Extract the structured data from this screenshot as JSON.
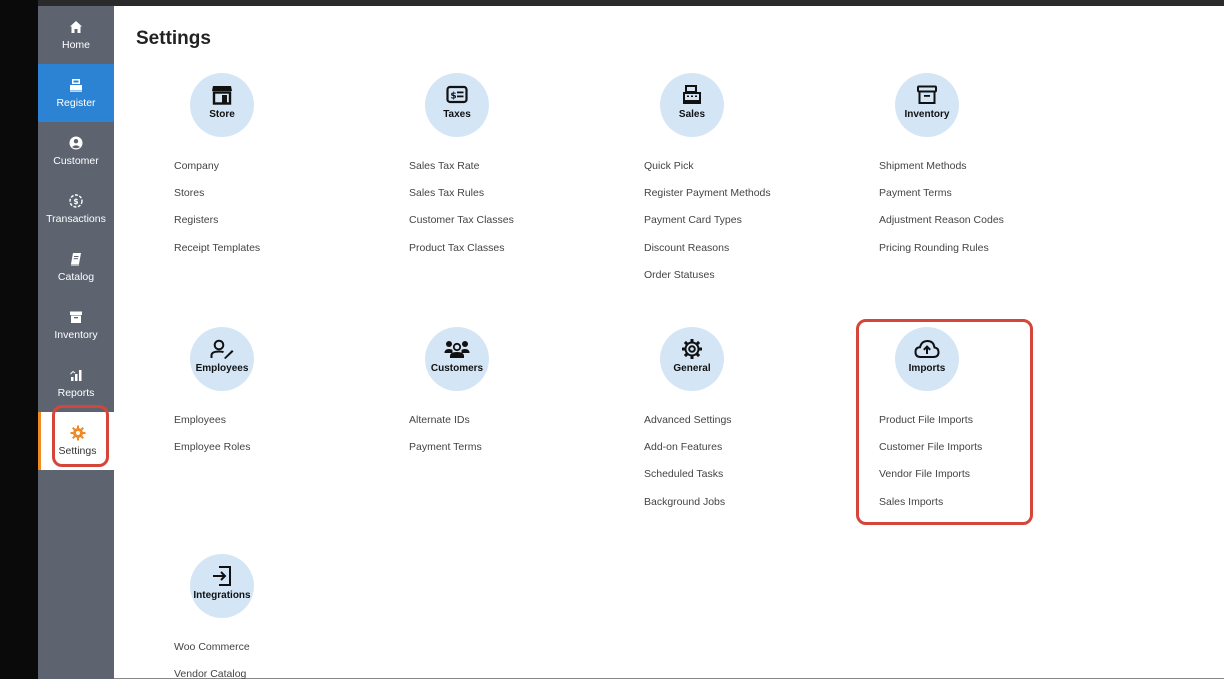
{
  "sidebar": {
    "items": [
      {
        "label": "Home",
        "icon": "home-icon"
      },
      {
        "label": "Register",
        "icon": "register-icon"
      },
      {
        "label": "Customer",
        "icon": "customer-icon"
      },
      {
        "label": "Transactions",
        "icon": "transactions-icon"
      },
      {
        "label": "Catalog",
        "icon": "catalog-icon"
      },
      {
        "label": "Inventory",
        "icon": "inventory-icon"
      },
      {
        "label": "Reports",
        "icon": "reports-icon"
      },
      {
        "label": "Settings",
        "icon": "settings-icon"
      }
    ],
    "active_color": "#2c83d3",
    "settings_accent": "#f08a24"
  },
  "page": {
    "title": "Settings"
  },
  "sections": {
    "store": {
      "title": "Store",
      "icon": "store-icon",
      "links": [
        "Company",
        "Stores",
        "Registers",
        "Receipt Templates"
      ]
    },
    "taxes": {
      "title": "Taxes",
      "icon": "taxes-icon",
      "links": [
        "Sales Tax Rate",
        "Sales Tax Rules",
        "Customer Tax Classes",
        "Product Tax Classes"
      ]
    },
    "sales": {
      "title": "Sales",
      "icon": "sales-icon",
      "links": [
        "Quick Pick",
        "Register Payment Methods",
        "Payment Card Types",
        "Discount Reasons",
        "Order Statuses"
      ]
    },
    "inventory": {
      "title": "Inventory",
      "icon": "inventory-box-icon",
      "links": [
        "Shipment Methods",
        "Payment Terms",
        "Adjustment Reason Codes",
        "Pricing Rounding Rules"
      ]
    },
    "employees": {
      "title": "Employees",
      "icon": "employees-icon",
      "links": [
        "Employees",
        "Employee Roles"
      ]
    },
    "customers": {
      "title": "Customers",
      "icon": "customers-icon",
      "links": [
        "Alternate IDs",
        "Payment Terms"
      ]
    },
    "general": {
      "title": "General",
      "icon": "gear-icon",
      "links": [
        "Advanced Settings",
        "Add-on Features",
        "Scheduled Tasks",
        "Background Jobs"
      ]
    },
    "imports": {
      "title": "Imports",
      "icon": "cloud-upload-icon",
      "links": [
        "Product File Imports",
        "Customer File Imports",
        "Vendor File Imports",
        "Sales Imports"
      ]
    },
    "integrations": {
      "title": "Integrations",
      "icon": "integrations-icon",
      "links": [
        "Woo Commerce",
        "Vendor Catalog"
      ]
    }
  },
  "colors": {
    "circle_bg": "#d4e6f6",
    "highlight": "#d6453a",
    "sidebar_bg": "#5d6470"
  }
}
